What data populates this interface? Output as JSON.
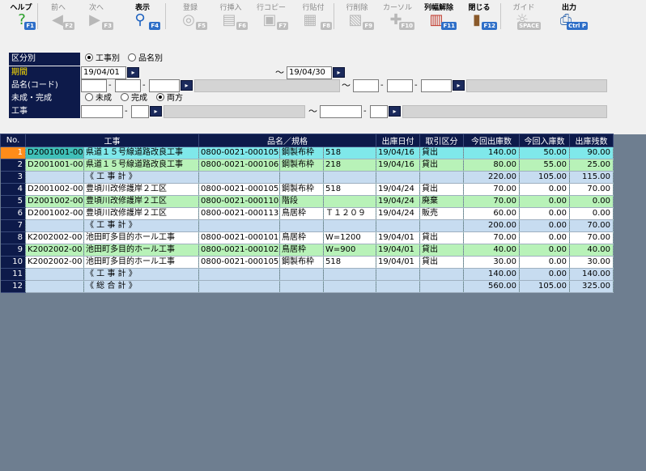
{
  "toolbar": {
    "buttons": [
      {
        "label": "ヘルプ",
        "key": "F1",
        "icon": "question-icon",
        "enabled": true
      },
      {
        "label": "前へ",
        "key": "F2",
        "icon": "arrow-left-icon",
        "enabled": false
      },
      {
        "label": "次へ",
        "key": "F3",
        "icon": "arrow-right-icon",
        "enabled": false
      },
      {
        "label": "表示",
        "key": "F4",
        "icon": "magnifier-icon",
        "enabled": true
      },
      {
        "label": "登録",
        "key": "F5",
        "icon": "register-icon",
        "enabled": false
      },
      {
        "label": "行挿入",
        "key": "F6",
        "icon": "row-insert-icon",
        "enabled": false
      },
      {
        "label": "行コピー",
        "key": "F7",
        "icon": "row-copy-icon",
        "enabled": false
      },
      {
        "label": "行貼付",
        "key": "F8",
        "icon": "row-paste-icon",
        "enabled": false
      },
      {
        "label": "行削除",
        "key": "F9",
        "icon": "row-delete-icon",
        "enabled": false
      },
      {
        "label": "カーソル",
        "key": "F10",
        "icon": "cursor-icon",
        "enabled": false
      },
      {
        "label": "列幅解除",
        "key": "F11",
        "icon": "column-width-icon",
        "enabled": true
      },
      {
        "label": "閉じる",
        "key": "F12",
        "icon": "door-icon",
        "enabled": true
      },
      {
        "label": "ガイド",
        "key": "SPACE",
        "icon": "lightbulb-icon",
        "enabled": false
      },
      {
        "label": "出力",
        "key": "Ctrl P",
        "icon": "printer-icon",
        "enabled": true
      }
    ]
  },
  "filter": {
    "kubun": {
      "label": "区分別",
      "options": [
        "工事別",
        "品名別"
      ],
      "selected": 0
    },
    "period": {
      "label": "期間",
      "from": "19/04/01",
      "tilde": "～",
      "to": "19/04/30"
    },
    "hinmei": {
      "label": "品名(コード)",
      "tilde": "～"
    },
    "status": {
      "label": "未成・完成",
      "options": [
        "未成",
        "完成",
        "両方"
      ],
      "selected": 2
    },
    "koji": {
      "label": "工事",
      "tilde": "～"
    }
  },
  "grid": {
    "headers": [
      "No.",
      "工事",
      "品名／規格",
      "出庫日付",
      "取引区分",
      "今回出庫数",
      "今回入庫数",
      "出庫残数"
    ],
    "rows": [
      {
        "no": "1",
        "code": "D2001001-00",
        "koji": "県道１５号線道路改良工事",
        "hcode": "0800-0021-000105",
        "hname": "鋼製布枠",
        "spec": "518",
        "date": "19/04/16",
        "kubun": "貸出",
        "out": "140.00",
        "in": "50.00",
        "rem": "90.00",
        "style": "cyan",
        "sel": true
      },
      {
        "no": "2",
        "code": "D2001001-00",
        "koji": "県道１５号線道路改良工事",
        "hcode": "0800-0021-000106",
        "hname": "鋼製布枠",
        "spec": "218",
        "date": "19/04/16",
        "kubun": "貸出",
        "out": "80.00",
        "in": "55.00",
        "rem": "25.00",
        "style": "green"
      },
      {
        "no": "3",
        "code": "",
        "koji": "《 工 事 計 》",
        "hcode": "",
        "hname": "",
        "spec": "",
        "date": "",
        "kubun": "",
        "out": "220.00",
        "in": "105.00",
        "rem": "115.00",
        "style": "blue"
      },
      {
        "no": "4",
        "code": "D2001002-00",
        "koji": "豊頃川改修護岸２工区",
        "hcode": "0800-0021-000105",
        "hname": "鋼製布枠",
        "spec": "518",
        "date": "19/04/24",
        "kubun": "貸出",
        "out": "70.00",
        "in": "0.00",
        "rem": "70.00",
        "style": "white"
      },
      {
        "no": "5",
        "code": "D2001002-00",
        "koji": "豊頃川改修護岸２工区",
        "hcode": "0800-0021-000110",
        "hname": "階段",
        "spec": "",
        "date": "19/04/24",
        "kubun": "廃棄",
        "out": "70.00",
        "in": "0.00",
        "rem": "0.00",
        "style": "green"
      },
      {
        "no": "6",
        "code": "D2001002-00",
        "koji": "豊頃川改修護岸２工区",
        "hcode": "0800-0021-000113",
        "hname": "鳥居枠",
        "spec": "Ｔ１２０９",
        "date": "19/04/24",
        "kubun": "販売",
        "out": "60.00",
        "in": "0.00",
        "rem": "0.00",
        "style": "white"
      },
      {
        "no": "7",
        "code": "",
        "koji": "《 工 事 計 》",
        "hcode": "",
        "hname": "",
        "spec": "",
        "date": "",
        "kubun": "",
        "out": "200.00",
        "in": "0.00",
        "rem": "70.00",
        "style": "blue"
      },
      {
        "no": "8",
        "code": "K2002002-00",
        "koji": "池田町多目的ホール工事",
        "hcode": "0800-0021-000101",
        "hname": "鳥居枠",
        "spec": "W=1200",
        "date": "19/04/01",
        "kubun": "貸出",
        "out": "70.00",
        "in": "0.00",
        "rem": "70.00",
        "style": "white"
      },
      {
        "no": "9",
        "code": "K2002002-00",
        "koji": "池田町多目的ホール工事",
        "hcode": "0800-0021-000102",
        "hname": "鳥居枠",
        "spec": "W=900",
        "date": "19/04/01",
        "kubun": "貸出",
        "out": "40.00",
        "in": "0.00",
        "rem": "40.00",
        "style": "green"
      },
      {
        "no": "10",
        "code": "K2002002-00",
        "koji": "池田町多目的ホール工事",
        "hcode": "0800-0021-000105",
        "hname": "鋼製布枠",
        "spec": "518",
        "date": "19/04/01",
        "kubun": "貸出",
        "out": "30.00",
        "in": "0.00",
        "rem": "30.00",
        "style": "white"
      },
      {
        "no": "11",
        "code": "",
        "koji": "《 工 事 計 》",
        "hcode": "",
        "hname": "",
        "spec": "",
        "date": "",
        "kubun": "",
        "out": "140.00",
        "in": "0.00",
        "rem": "140.00",
        "style": "blue"
      },
      {
        "no": "12",
        "code": "",
        "koji": "《 総 合 計 》",
        "hcode": "",
        "hname": "",
        "spec": "",
        "date": "",
        "kubun": "",
        "out": "560.00",
        "in": "105.00",
        "rem": "325.00",
        "style": "blue"
      }
    ]
  }
}
